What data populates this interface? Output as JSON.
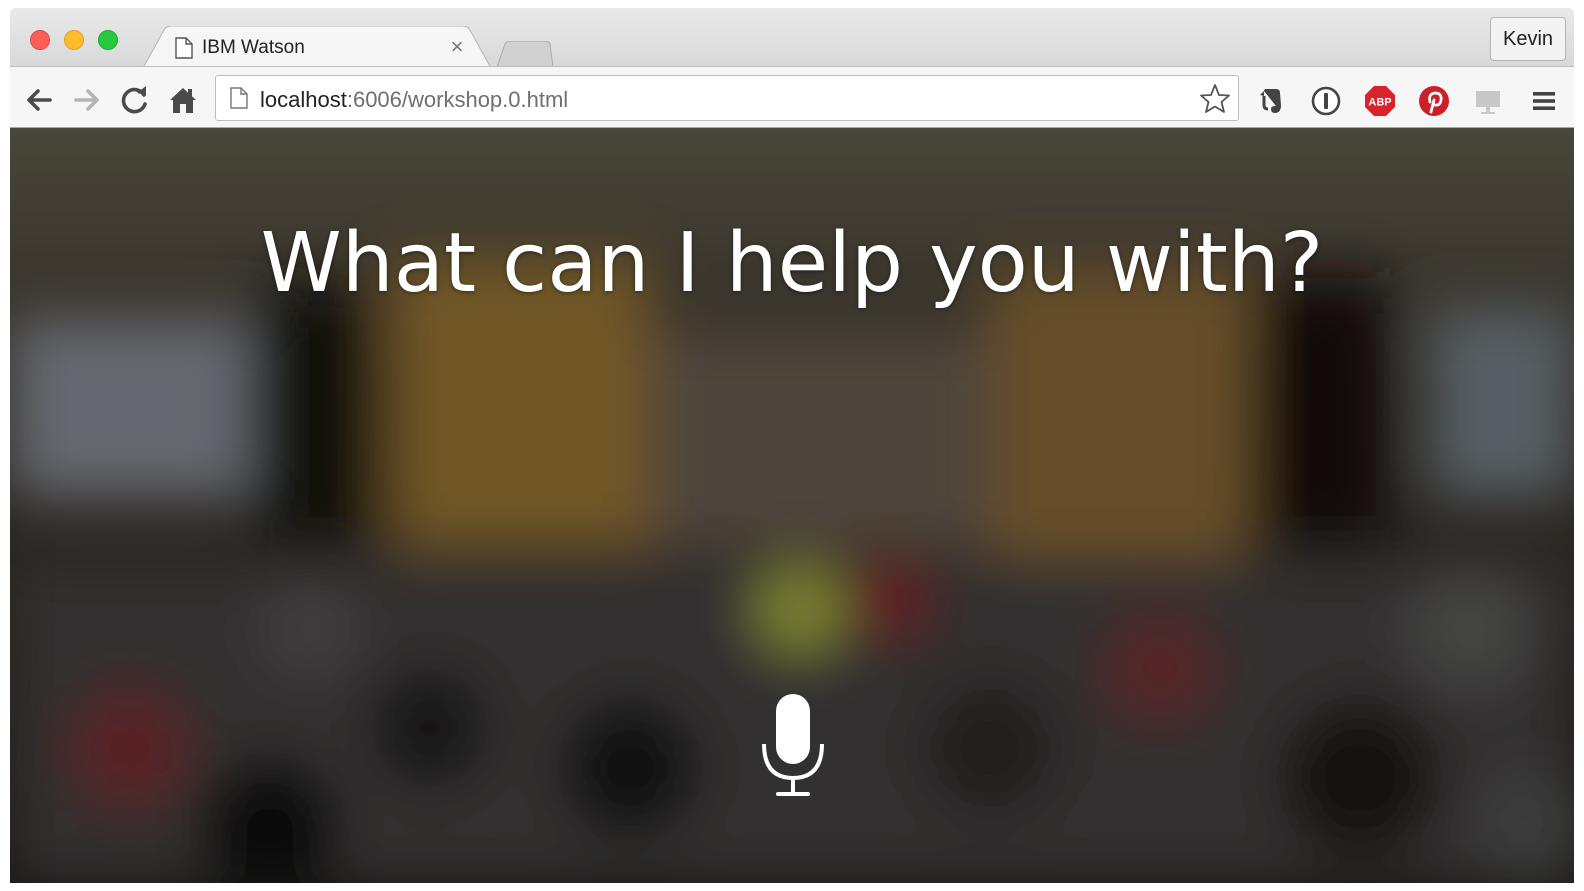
{
  "browser": {
    "tab": {
      "title": "IBM Watson",
      "close_glyph": "×"
    },
    "profile": "Kevin",
    "address": {
      "host": "localhost",
      "path": ":6006/workshop.0.html"
    },
    "extensions": [
      "evernote-icon",
      "1password-icon",
      "adblock-plus-icon",
      "pinterest-icon",
      "cast-icon"
    ],
    "colors": {
      "close": "#fc5f57",
      "minimize": "#fdbc2e",
      "zoom": "#28c840",
      "abp": "#d8232a",
      "pinterest": "#cb2027"
    }
  },
  "page": {
    "headline": "What can I help you with?",
    "mic_icon": "microphone-icon"
  }
}
